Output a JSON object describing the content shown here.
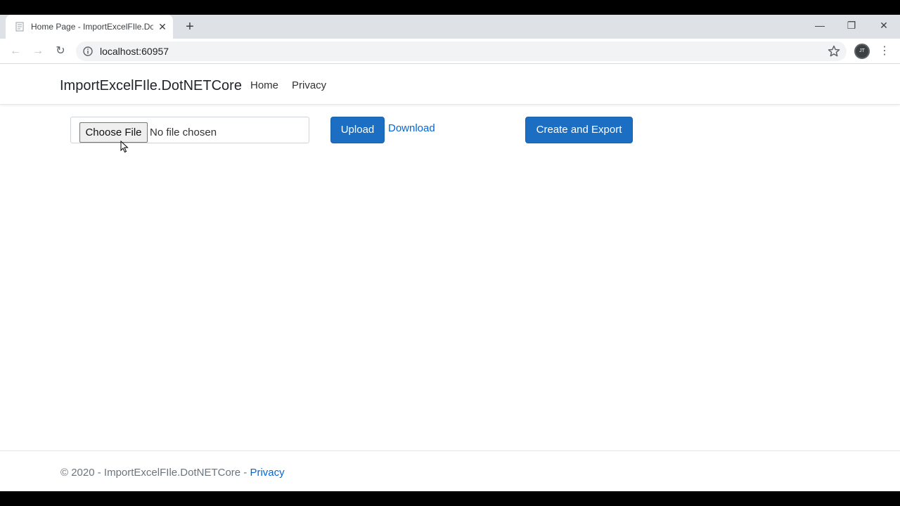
{
  "browser": {
    "tab": {
      "title": "Home Page - ImportExcelFIle.DotNETCore",
      "favicon": "page-icon",
      "close": "✕"
    },
    "new_tab": "+",
    "window_controls": {
      "minimize": "—",
      "restore": "❐",
      "close": "✕"
    },
    "toolbar": {
      "back": "←",
      "forward": "→",
      "reload": "↻",
      "url": "localhost:60957",
      "avatar_initials": "JT",
      "menu": "⋮"
    }
  },
  "navbar": {
    "brand": "ImportExcelFIle.DotNETCore",
    "links": [
      {
        "label": "Home"
      },
      {
        "label": "Privacy"
      }
    ]
  },
  "main": {
    "file_input": {
      "button_label": "Choose File",
      "status": "No file chosen"
    },
    "upload_label": "Upload",
    "download_label": "Download",
    "create_export_label": "Create and Export"
  },
  "footer": {
    "text": "© 2020 - ImportExcelFIle.DotNETCore - ",
    "link": "Privacy"
  },
  "colors": {
    "primary": "#1b6ec2",
    "link": "#0366d6",
    "chrome_tabstrip": "#dee1e6"
  }
}
